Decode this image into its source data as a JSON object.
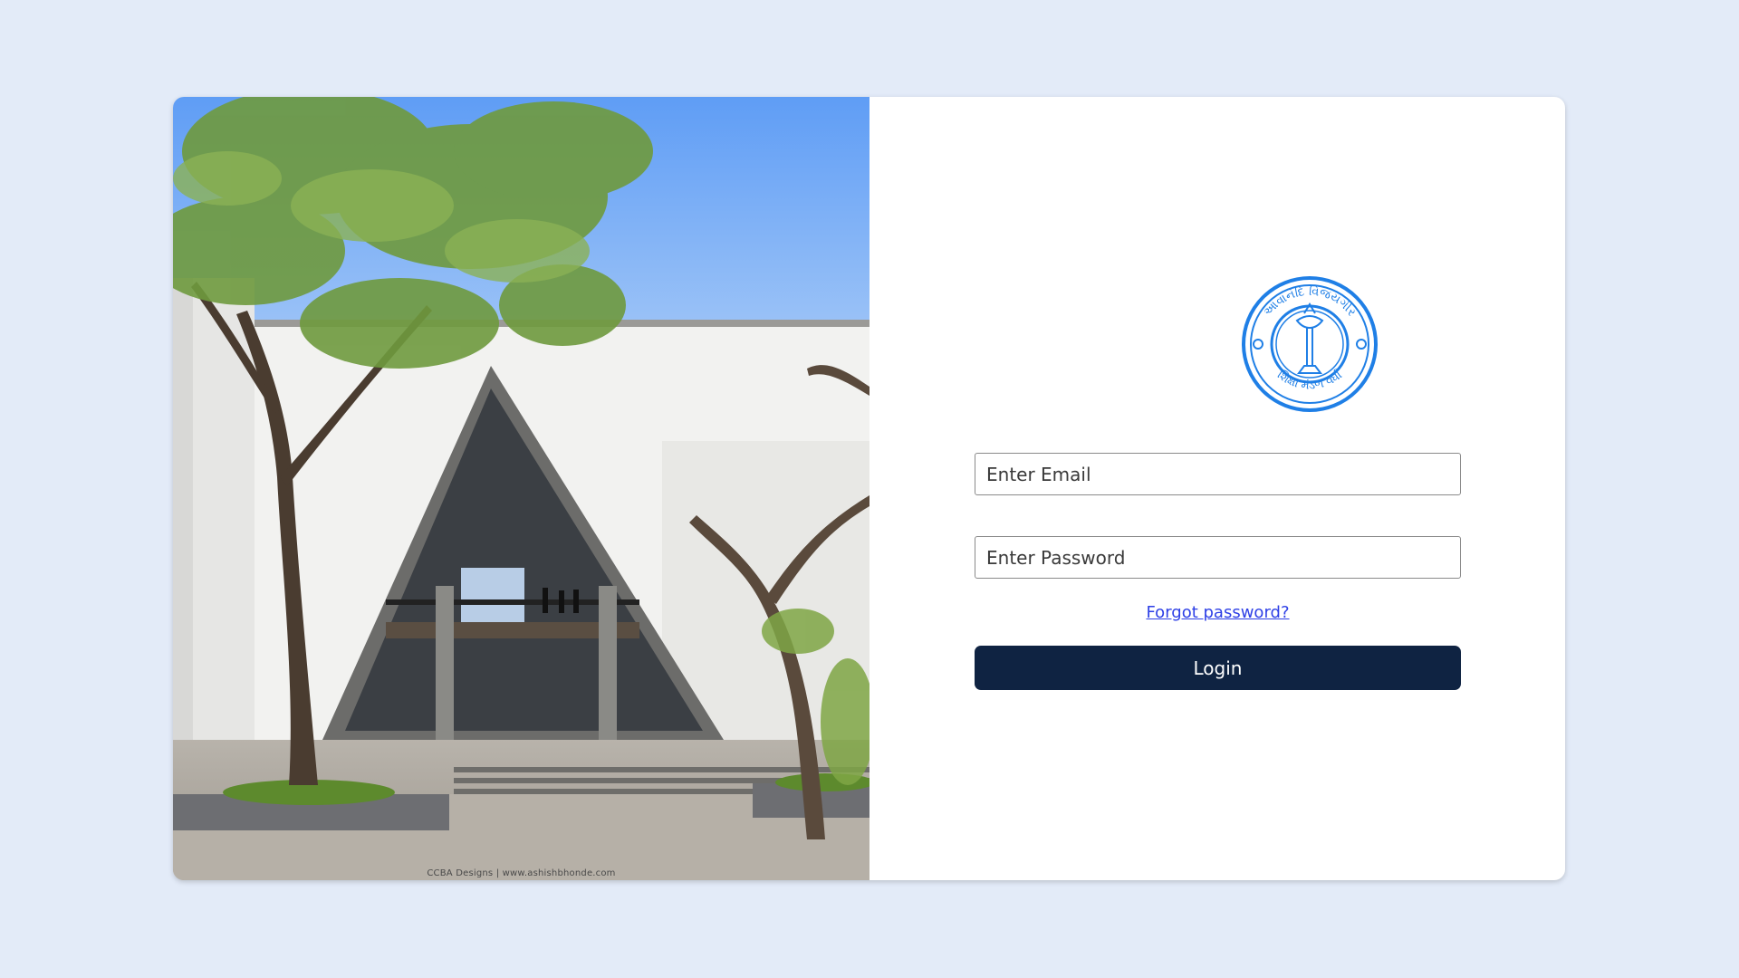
{
  "photo": {
    "credit": "CCBA Designs | www.ashishbhonde.com"
  },
  "login": {
    "seal_text_top": "આવાનંદિ વિજયગીર",
    "seal_text_bottom": "શિક્ષા મંડળ વર્ધા",
    "email_placeholder": "Enter Email",
    "password_placeholder": "Enter Password",
    "forgot_label": "Forgot password?",
    "login_label": "Login"
  },
  "colors": {
    "page_background": "#e3ebf8",
    "seal_blue": "#1f7fe6",
    "button_background": "#0f2342",
    "link": "#2d3fe6"
  }
}
